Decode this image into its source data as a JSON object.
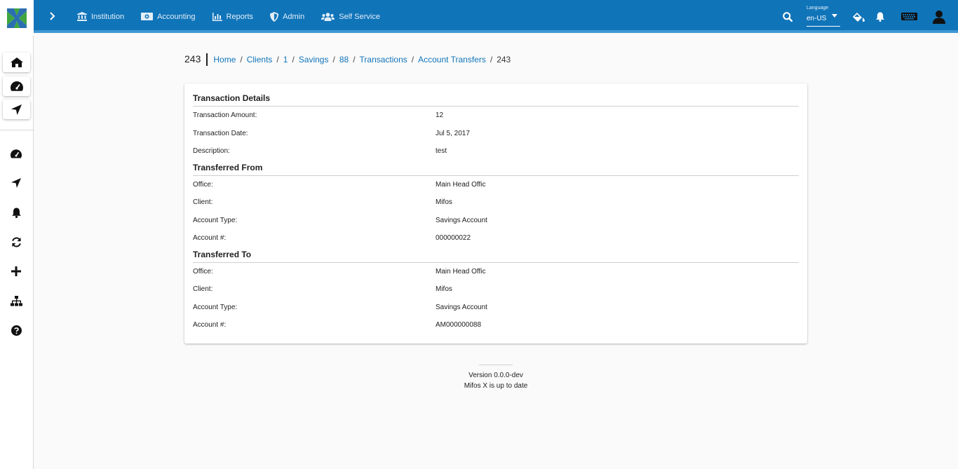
{
  "topbar": {
    "nav": [
      {
        "label": "Institution",
        "icon": "institution-icon"
      },
      {
        "label": "Accounting",
        "icon": "money-icon"
      },
      {
        "label": "Reports",
        "icon": "chart-icon"
      },
      {
        "label": "Admin",
        "icon": "shield-icon"
      },
      {
        "label": "Self Service",
        "icon": "users-icon"
      }
    ],
    "language": {
      "label": "Language",
      "value": "en-US"
    },
    "colors": {
      "bar": "#1074b9",
      "accent": "#3f97d4"
    }
  },
  "breadcrumb": {
    "title": "243",
    "links": [
      "Home",
      "Clients",
      "1",
      "Savings",
      "88",
      "Transactions",
      "Account Transfers"
    ],
    "current": "243"
  },
  "details": {
    "transaction": {
      "title": "Transaction Details",
      "rows": [
        {
          "label": "Transaction Amount:",
          "value": "12"
        },
        {
          "label": "Transaction Date:",
          "value": "Jul 5, 2017"
        },
        {
          "label": "Description:",
          "value": "test"
        }
      ]
    },
    "from": {
      "title": "Transferred From",
      "rows": [
        {
          "label": "Office:",
          "value": "Main Head Offic"
        },
        {
          "label": "Client:",
          "value": "Mifos"
        },
        {
          "label": "Account Type:",
          "value": "Savings Account"
        },
        {
          "label": "Account #:",
          "value": "000000022"
        }
      ]
    },
    "to": {
      "title": "Transferred To",
      "rows": [
        {
          "label": "Office:",
          "value": "Main Head Offic"
        },
        {
          "label": "Client:",
          "value": "Mifos"
        },
        {
          "label": "Account Type:",
          "value": "Savings Account"
        },
        {
          "label": "Account #:",
          "value": "AM000000088"
        }
      ]
    }
  },
  "footer": {
    "version": "Version 0.0.0-dev",
    "status": "Mifos X is up to date"
  }
}
